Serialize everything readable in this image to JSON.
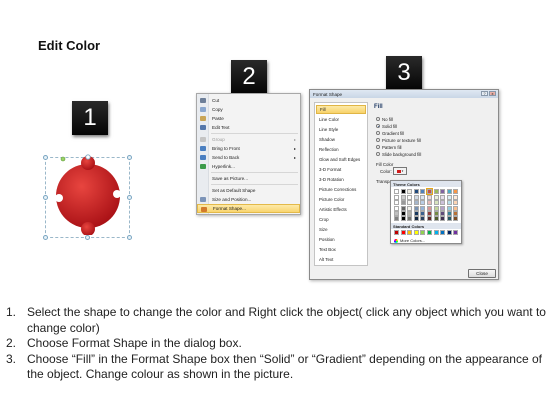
{
  "title": "Edit Color",
  "steps": [
    "1",
    "2",
    "3"
  ],
  "context_menu": {
    "items": [
      {
        "label": "Cut",
        "icon": "scissors-icon",
        "disabled": false
      },
      {
        "label": "Copy",
        "icon": "copy-icon",
        "disabled": false
      },
      {
        "label": "Paste",
        "icon": "paste-icon",
        "disabled": false
      },
      {
        "label": "Edit Text",
        "icon": "edit-text-icon",
        "disabled": false
      },
      {
        "label": "Group",
        "icon": "group-icon",
        "disabled": true,
        "submenu": true
      },
      {
        "label": "Bring to Front",
        "icon": "bring-front-icon",
        "disabled": false,
        "submenu": true
      },
      {
        "label": "Send to Back",
        "icon": "send-back-icon",
        "disabled": false,
        "submenu": true
      },
      {
        "label": "Hyperlink...",
        "icon": "hyperlink-icon",
        "disabled": false
      },
      {
        "label": "Save as Picture...",
        "icon": "",
        "disabled": false
      },
      {
        "label": "Set as Default Shape",
        "icon": "",
        "disabled": false
      },
      {
        "label": "Size and Position...",
        "icon": "size-icon",
        "disabled": false
      },
      {
        "label": "Format Shape...",
        "icon": "format-shape-icon",
        "disabled": false,
        "highlighted": true
      }
    ]
  },
  "dialog": {
    "title": "Format Shape",
    "help": "?",
    "close_x": "x",
    "categories": [
      "Fill",
      "Line Color",
      "Line Style",
      "Shadow",
      "Reflection",
      "Glow and Soft Edges",
      "3-D Format",
      "3-D Rotation",
      "Picture Corrections",
      "Picture Color",
      "Artistic Effects",
      "Crop",
      "Size",
      "Position",
      "Text Box",
      "Alt Text"
    ],
    "selected_category": "Fill",
    "fill_heading": "Fill",
    "fill_options": [
      {
        "label": "No fill",
        "selected": false
      },
      {
        "label": "Solid fill",
        "selected": true
      },
      {
        "label": "Gradient fill",
        "selected": false
      },
      {
        "label": "Picture or texture fill",
        "selected": false
      },
      {
        "label": "Pattern fill",
        "selected": false
      },
      {
        "label": "Slide background fill",
        "selected": false
      }
    ],
    "fill_color_label": "Fill Color",
    "color_label": "Color:",
    "transparency_label": "Transpa",
    "theme_colors_label": "Theme Colors",
    "standard_colors_label": "Standard Colors",
    "more_colors_label": "More Colors...",
    "theme_top_row": [
      "#ffffff",
      "#000000",
      "#eeece1",
      "#1f497d",
      "#4f81bd",
      "#c0504d",
      "#9bbb59",
      "#8064a2",
      "#4bacc6",
      "#f79646"
    ],
    "standard_colors": [
      "#c00000",
      "#ff0000",
      "#ffc000",
      "#ffff00",
      "#92d050",
      "#00b050",
      "#00b0f0",
      "#0070c0",
      "#002060",
      "#7030a0"
    ],
    "close_button": "Close"
  },
  "shape_color": "#d21f25",
  "instructions": [
    {
      "num": "1.",
      "text": "Select the shape to change the color and Right click the object( click any object which you want to change color)"
    },
    {
      "num": "2.",
      "text": "Choose Format Shape in the dialog box."
    },
    {
      "num": "3.",
      "text": "Choose “Fill” in the Format Shape box then “Solid” or “Gradient” depending on the appearance of the object. Change colour as shown in the picture."
    }
  ]
}
